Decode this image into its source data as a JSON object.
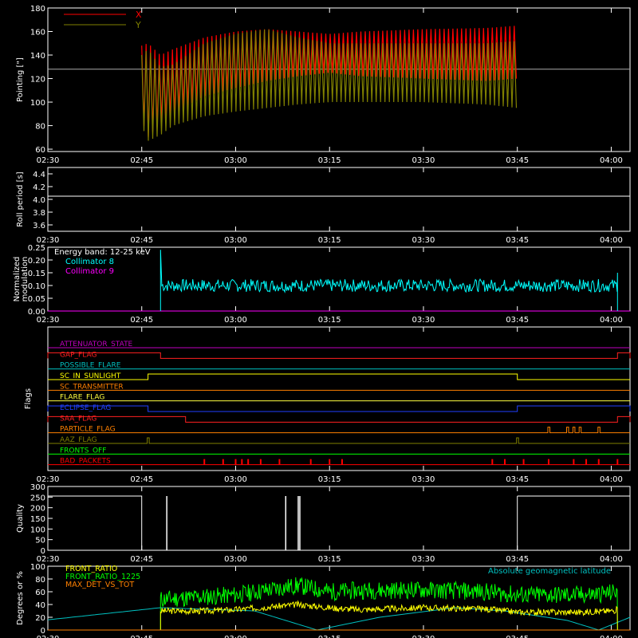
{
  "theme": {
    "background": "#000000",
    "foreground": "#ffffff"
  },
  "x_ticks": [
    "02:30",
    "02:45",
    "03:00",
    "03:15",
    "03:30",
    "03:45",
    "04:00"
  ],
  "chart_data": [
    {
      "type": "line",
      "ylabel": "Pointing [\"]",
      "ylim": [
        58,
        180
      ],
      "yticks": [
        60,
        80,
        100,
        120,
        140,
        160,
        180
      ],
      "x_range": [
        "02:30",
        "04:03"
      ],
      "reference_line": 128,
      "legend": [
        {
          "name": "X",
          "color": "#ff0000"
        },
        {
          "name": "Y",
          "color": "#808000"
        }
      ],
      "series": [
        {
          "name": "X",
          "color": "#ff0000",
          "x": [
            "02:45",
            "02:46",
            "02:48",
            "02:50",
            "02:55",
            "03:00",
            "03:05",
            "03:10",
            "03:15",
            "03:20",
            "03:30",
            "03:40",
            "03:45"
          ],
          "upper": [
            148,
            150,
            140,
            145,
            155,
            160,
            162,
            160,
            158,
            160,
            162,
            163,
            165
          ],
          "lower": [
            85,
            70,
            82,
            90,
            105,
            112,
            118,
            122,
            125,
            122,
            120,
            118,
            120
          ]
        },
        {
          "name": "Y",
          "color": "#808000",
          "x": [
            "02:45",
            "02:46",
            "02:48",
            "02:50",
            "02:55",
            "03:00",
            "03:05",
            "03:10",
            "03:15",
            "03:20",
            "03:30",
            "03:40",
            "03:45"
          ],
          "upper": [
            140,
            145,
            130,
            132,
            150,
            158,
            162,
            155,
            150,
            150,
            150,
            150,
            152
          ],
          "lower": [
            80,
            67,
            72,
            80,
            88,
            92,
            95,
            98,
            100,
            100,
            100,
            98,
            95
          ]
        }
      ]
    },
    {
      "type": "line",
      "ylabel": "Roll period [s]",
      "ylim": [
        3.5,
        4.5
      ],
      "yticks": [
        "3.6",
        "3.8",
        "4.0",
        "4.2",
        "4.4"
      ],
      "series": [
        {
          "color": "#ffffff",
          "x": [
            "02:30",
            "04:03"
          ],
          "y": [
            4.05,
            4.05
          ]
        }
      ]
    },
    {
      "type": "line",
      "ylabel": "Normalized modulation",
      "ylim": [
        0,
        0.25
      ],
      "yticks": [
        "0.00",
        "0.05",
        "0.10",
        "0.15",
        "0.20",
        "0.25"
      ],
      "annotation": "Energy band: 12-25 keV",
      "legend": [
        {
          "name": "Collimator 8",
          "color": "#00ffff"
        },
        {
          "name": "Collimator 9",
          "color": "#ff00ff"
        }
      ],
      "series": [
        {
          "name": "Collimator 8",
          "color": "#00ffff",
          "start": "02:48",
          "end": "04:01",
          "typical": 0.1,
          "peak": 0.24
        },
        {
          "name": "Collimator 9",
          "color": "#ff00ff",
          "x": [
            "02:30",
            "04:03"
          ],
          "y": [
            0.0,
            0.0
          ]
        }
      ]
    },
    {
      "type": "line",
      "ylabel": "Flags",
      "flags": [
        {
          "name": "ATTENUATOR_STATE",
          "color": "#c000c0",
          "on": []
        },
        {
          "name": "GAP_FLAG",
          "color": "#ff2020",
          "on": [
            [
              "02:30",
              "02:48"
            ],
            [
              "04:01",
              "04:03"
            ]
          ]
        },
        {
          "name": "POSSIBLE_FLARE",
          "color": "#00c0c0",
          "on": []
        },
        {
          "name": "SC_IN_SUNLIGHT",
          "color": "#ffff00",
          "on": [
            [
              "02:46",
              "03:45"
            ]
          ]
        },
        {
          "name": "SC_TRANSMITTER",
          "color": "#ff8000",
          "on": []
        },
        {
          "name": "FLARE_FLAG",
          "color": "#ffff40",
          "on": []
        },
        {
          "name": "ECLIPSE_FLAG",
          "color": "#2040ff",
          "on": [
            [
              "02:30",
              "02:46"
            ],
            [
              "03:45",
              "04:03"
            ]
          ]
        },
        {
          "name": "SAA_FLAG",
          "color": "#ff2020",
          "on": [
            [
              "02:30",
              "02:52"
            ],
            [
              "04:01",
              "04:03"
            ]
          ]
        },
        {
          "name": "PARTICLE_FLAG",
          "color": "#ff8000",
          "pulses": [
            "03:50",
            "03:53",
            "03:54",
            "03:55",
            "03:58"
          ]
        },
        {
          "name": "AAZ_FLAG",
          "color": "#808000",
          "pulses": [
            "02:46",
            "03:45"
          ]
        },
        {
          "name": "FRONTS_OFF",
          "color": "#00ff00",
          "on": []
        },
        {
          "name": "BAD_PACKETS",
          "color": "#ff0000",
          "ticks": [
            "02:55",
            "02:58",
            "03:00",
            "03:01",
            "03:02",
            "03:04",
            "03:07",
            "03:12",
            "03:15",
            "03:17",
            "03:41",
            "03:43",
            "03:46",
            "03:50",
            "03:54",
            "03:56",
            "03:58",
            "04:01"
          ]
        }
      ]
    },
    {
      "type": "line",
      "ylabel": "Quality",
      "ylim": [
        0,
        300
      ],
      "yticks": [
        0,
        50,
        100,
        150,
        200,
        250,
        300
      ],
      "series": [
        {
          "color": "#ffffff",
          "high_intervals": [
            [
              "02:30",
              "02:45"
            ],
            [
              "03:45",
              "04:03"
            ]
          ],
          "spikes": [
            "02:49",
            "03:08",
            "03:10",
            "03:10"
          ],
          "high_value": 255
        }
      ]
    },
    {
      "type": "line",
      "ylabel": "Degrees or %",
      "ylim": [
        0,
        100
      ],
      "yticks": [
        0,
        20,
        40,
        60,
        80,
        100
      ],
      "annotation": "Absolute geomagnetic latitude",
      "legend": [
        {
          "name": "FRONT_RATIO",
          "color": "#ffff00"
        },
        {
          "name": "FRONT_RATIO_1225",
          "color": "#00ff00"
        },
        {
          "name": "MAX_DET_VS_TOT",
          "color": "#ff8000"
        }
      ],
      "series": [
        {
          "name": "FRONT_RATIO",
          "color": "#ffff00",
          "x": [
            "02:48",
            "02:55",
            "03:00",
            "03:10",
            "03:15",
            "03:20",
            "03:30",
            "03:40",
            "03:45",
            "03:55",
            "04:00",
            "04:01"
          ],
          "y": [
            30,
            30,
            32,
            40,
            35,
            32,
            35,
            33,
            28,
            28,
            30,
            32
          ]
        },
        {
          "name": "FRONT_RATIO_1225",
          "color": "#00ff00",
          "x": [
            "02:48",
            "02:55",
            "03:00",
            "03:10",
            "03:15",
            "03:20",
            "03:30",
            "03:40",
            "03:45",
            "03:55",
            "04:00",
            "04:01"
          ],
          "y": [
            48,
            52,
            55,
            70,
            60,
            62,
            63,
            60,
            55,
            55,
            58,
            62
          ]
        },
        {
          "name": "Absolute geomagnetic latitude",
          "color": "#00c0c0",
          "x": [
            "02:30",
            "02:48",
            "03:03",
            "03:13",
            "03:23",
            "03:35",
            "03:43",
            "03:53",
            "03:58",
            "04:03"
          ],
          "y": [
            16,
            35,
            30,
            0,
            20,
            35,
            30,
            15,
            0,
            20
          ]
        }
      ]
    }
  ]
}
